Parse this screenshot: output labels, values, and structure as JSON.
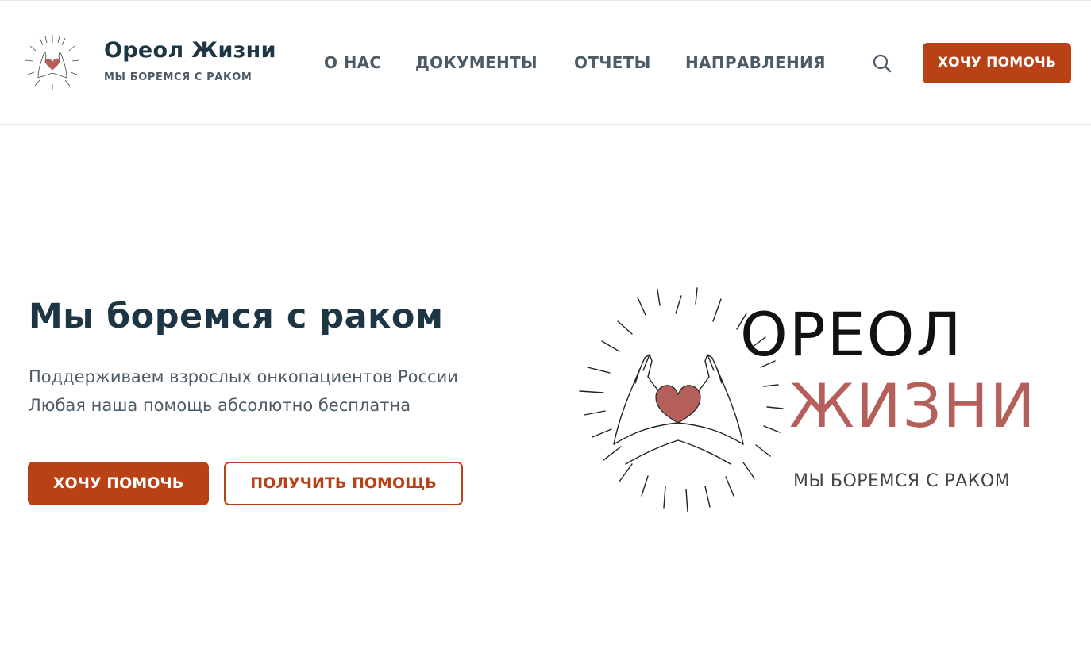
{
  "header": {
    "logo_icon": "heart-hands-logo",
    "site_title": "Ореол Жизни",
    "tagline": "МЫ БОРЕМСЯ С РАКОМ",
    "nav": [
      {
        "label": "О НАС"
      },
      {
        "label": "ДОКУМЕНТЫ"
      },
      {
        "label": "ОТЧЕТЫ"
      },
      {
        "label": "НАПРАВЛЕНИЯ"
      }
    ],
    "search_icon": "search-icon",
    "cta_label": "ХОЧУ ПОМОЧЬ"
  },
  "hero": {
    "title": "Мы боремся с раком",
    "line1": "Поддерживаем взрослых онкопациентов России",
    "line2": "Любая наша помощь абсолютно бесплатна",
    "primary_button": "ХОЧУ ПОМОЧЬ",
    "secondary_button": "ПОЛУЧИТЬ ПОМОЩЬ",
    "brand": {
      "line1": "ОРЕОЛ",
      "line2": "ЖИЗНИ",
      "line3": "МЫ БОРЕМСЯ С РАКОМ"
    }
  },
  "colors": {
    "accent": "#b84115",
    "heading": "#1d3646",
    "text": "#4c5b66",
    "heart": "#b55f5a"
  }
}
